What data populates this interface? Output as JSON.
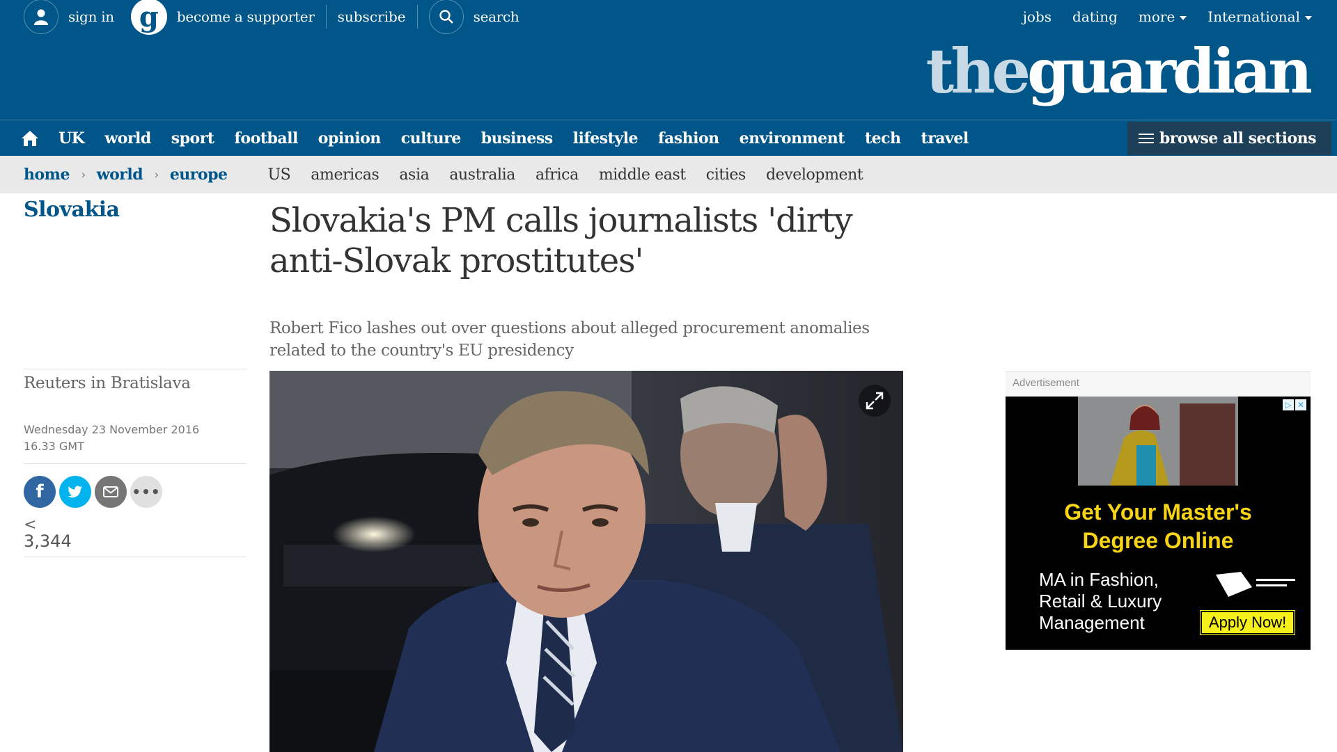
{
  "topbar": {
    "sign_in": "sign in",
    "supporter": "become a supporter",
    "subscribe": "subscribe",
    "search": "search",
    "right": [
      "jobs",
      "dating",
      "more",
      "International"
    ]
  },
  "brand": {
    "the": "the",
    "guardian": "guardian",
    "supporter_mark": "g"
  },
  "nav": {
    "items": [
      "UK",
      "world",
      "sport",
      "football",
      "opinion",
      "culture",
      "business",
      "lifestyle",
      "fashion",
      "environment",
      "tech",
      "travel"
    ],
    "browse": "browse all sections"
  },
  "subnav": {
    "breadcrumb": [
      "home",
      "world",
      "europe"
    ],
    "links": [
      "US",
      "americas",
      "asia",
      "australia",
      "africa",
      "middle east",
      "cities",
      "development"
    ]
  },
  "article": {
    "section": "Slovakia",
    "headline": "Slovakia's PM calls journalists 'dirty anti-Slovak prostitutes'",
    "standfirst": "Robert Fico lashes out over questions about alleged procurement anomalies related to the country's EU presidency",
    "byline": "Reuters in Bratislava",
    "date": "Wednesday 23 November 2016",
    "time": "16.33 GMT",
    "share_count": "3,344",
    "share_icon": "<"
  },
  "ad": {
    "label": "Advertisement",
    "headline_1": "Get Your Master's",
    "headline_2": "Degree Online",
    "body_1": "MA in Fashion,",
    "body_2": "Retail & Luxury",
    "body_3": "Management",
    "cta": "Apply Now!"
  },
  "colors": {
    "brand_blue": "#005689",
    "browse_bg": "#1d3f57",
    "ad_yellow": "#f7d417"
  },
  "icons": [
    "user-icon",
    "search-icon",
    "home-icon",
    "menu-icon",
    "facebook-icon",
    "twitter-icon",
    "email-icon",
    "more-icon",
    "expand-icon"
  ]
}
